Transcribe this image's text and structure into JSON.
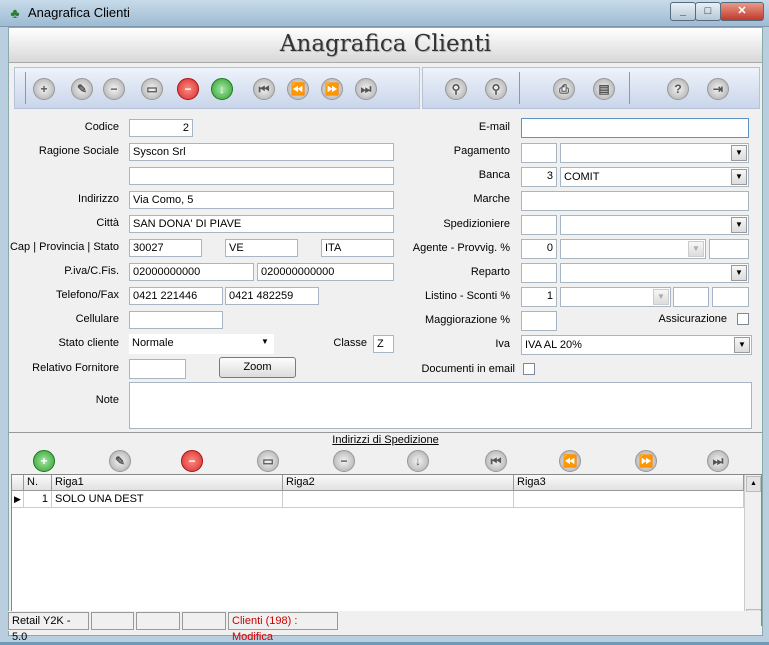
{
  "window": {
    "title": "Anagrafica Clienti",
    "minimize": "_",
    "maximize": "□",
    "close": "✕"
  },
  "banner": {
    "title": "Anagrafica Clienti"
  },
  "toolbar": {
    "left": [
      {
        "name": "new-record-icon",
        "glyph": "+",
        "style": "grey"
      },
      {
        "name": "edit-icon",
        "glyph": "✎",
        "style": "grey"
      },
      {
        "name": "delete-record-icon",
        "glyph": "−",
        "style": "grey"
      },
      {
        "name": "print-preview-icon",
        "glyph": "▭",
        "style": "grey"
      },
      {
        "name": "cancel-icon",
        "glyph": "−",
        "style": "red"
      },
      {
        "name": "confirm-icon",
        "glyph": "↓",
        "style": "green"
      },
      {
        "name": "first-record-icon",
        "glyph": "⏮",
        "style": "grey"
      },
      {
        "name": "previous-record-icon",
        "glyph": "⏪",
        "style": "grey"
      },
      {
        "name": "next-record-icon",
        "glyph": "⏩",
        "style": "grey"
      },
      {
        "name": "last-record-icon",
        "glyph": "⏭",
        "style": "grey"
      }
    ],
    "right": [
      {
        "name": "search-icon",
        "glyph": "⚲",
        "style": "grey"
      },
      {
        "name": "advanced-search-icon",
        "glyph": "⚲",
        "style": "grey"
      },
      {
        "name": "printer-icon",
        "glyph": "⎙",
        "style": "grey"
      },
      {
        "name": "export-icon",
        "glyph": "▤",
        "style": "grey"
      },
      {
        "name": "help-icon",
        "glyph": "?",
        "style": "grey"
      },
      {
        "name": "exit-icon",
        "glyph": "⇥",
        "style": "grey"
      }
    ]
  },
  "form": {
    "codice": {
      "label": "Codice",
      "value": "2"
    },
    "ragione_sociale": {
      "label": "Ragione Sociale",
      "value": "Syscon Srl",
      "value2": ""
    },
    "indirizzo": {
      "label": "Indirizzo",
      "value": "Via Como, 5"
    },
    "citta": {
      "label": "Città",
      "value": "SAN DONA' DI PIAVE"
    },
    "cap": {
      "label": "Cap | Provincia | Stato",
      "cap": "30027",
      "provincia": "VE",
      "stato": "ITA"
    },
    "piva": {
      "label": "P.iva/C.Fis.",
      "piva": "02000000000",
      "cfis": "020000000000"
    },
    "telefono": {
      "label": "Telefono/Fax",
      "tel": "0421 221446",
      "fax": "0421 482259"
    },
    "cellulare": {
      "label": "Cellulare",
      "value": ""
    },
    "stato_cliente": {
      "label": "Stato cliente",
      "value": "Normale"
    },
    "classe": {
      "label": "Classe",
      "value": "Z"
    },
    "relativo_fornitore": {
      "label": "Relativo Fornitore",
      "value": "",
      "zoom": "Zoom"
    },
    "note": {
      "label": "Note",
      "value": ""
    },
    "email": {
      "label": "E-mail",
      "value": ""
    },
    "pagamento": {
      "label": "Pagamento",
      "code": "",
      "value": ""
    },
    "banca": {
      "label": "Banca",
      "code": "3",
      "value": "COMIT"
    },
    "marche": {
      "label": "Marche",
      "value": ""
    },
    "spedizioniere": {
      "label": "Spedizioniere",
      "code": "",
      "value": ""
    },
    "agente": {
      "label": "Agente - Provvig. %",
      "code": "0",
      "value": "",
      "provv": ""
    },
    "reparto": {
      "label": "Reparto",
      "code": "",
      "value": ""
    },
    "listino": {
      "label": "Listino - Sconti %",
      "code": "1",
      "value": "",
      "sconto1": "",
      "sconto2": ""
    },
    "maggiorazione": {
      "label": "Maggiorazione %",
      "value": ""
    },
    "assicurazione": {
      "label": "Assicurazione",
      "checked": false
    },
    "iva": {
      "label": "Iva",
      "value": "IVA AL 20%"
    },
    "documenti_email": {
      "label": "Documenti in email",
      "checked": false
    }
  },
  "spedizione": {
    "title": "Indirizzi di Spedizione",
    "toolbar": [
      {
        "name": "add-address-icon",
        "glyph": "+",
        "style": "green"
      },
      {
        "name": "edit-address-icon",
        "glyph": "✎",
        "style": "grey"
      },
      {
        "name": "delete-address-icon",
        "glyph": "−",
        "style": "red"
      },
      {
        "name": "print-address-icon",
        "glyph": "▭",
        "style": "grey"
      },
      {
        "name": "cancel-address-icon",
        "glyph": "−",
        "style": "grey"
      },
      {
        "name": "confirm-address-icon",
        "glyph": "↓",
        "style": "grey"
      },
      {
        "name": "first-address-icon",
        "glyph": "⏮",
        "style": "grey"
      },
      {
        "name": "previous-address-icon",
        "glyph": "⏪",
        "style": "grey"
      },
      {
        "name": "next-address-icon",
        "glyph": "⏩",
        "style": "grey"
      },
      {
        "name": "last-address-icon",
        "glyph": "⏭",
        "style": "grey"
      }
    ],
    "columns": [
      "N.",
      "Riga1",
      "Riga2",
      "Riga3"
    ],
    "rows": [
      {
        "n": "1",
        "riga1": "SOLO UNA DEST",
        "riga2": "",
        "riga3": ""
      }
    ]
  },
  "statusbar": {
    "version": "Retail Y2K - 5.0",
    "p2": "",
    "p3": "",
    "p4": "",
    "status": "Clienti (198) : Modifica",
    "status_color": "#cc0000"
  }
}
